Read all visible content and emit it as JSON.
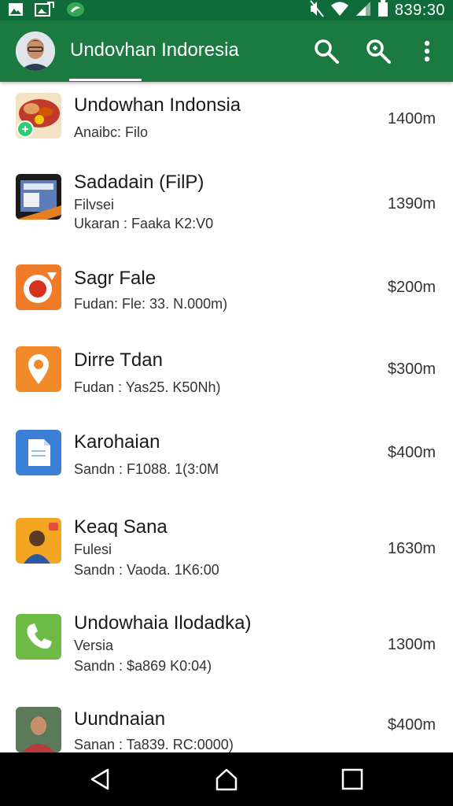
{
  "status_bar": {
    "time": "839:30",
    "icons": [
      "gallery-icon",
      "image-icon",
      "leaf-app-icon",
      "mute-icon",
      "wifi-icon",
      "signal-icon",
      "battery-icon"
    ]
  },
  "app_bar": {
    "title": "Undovhan Indoresia",
    "icons": [
      "search-icon",
      "zoom-search-icon",
      "more-vert-icon"
    ],
    "color": "#1a7a40"
  },
  "list": [
    {
      "title": "Undowhan Indonsia",
      "lines": [
        "Anaibc: Filo"
      ],
      "amount": "1400m",
      "thumb": "food-thumbnail"
    },
    {
      "title": "Sadadain (FilP)",
      "lines": [
        "Filvsei",
        "Ukaran : Faaka  K2:V0"
      ],
      "amount": "1390m",
      "thumb": "device-thumbnail"
    },
    {
      "title": "Sagr Fale",
      "lines": [
        "Fudan: Fle: 33. N.000m)"
      ],
      "amount": "$200m",
      "thumb": "record-app-icon"
    },
    {
      "title": "Dirre Tdan",
      "lines": [
        "Fudan : Yas25. K50Nh)"
      ],
      "amount": "$300m",
      "thumb": "pin-app-icon"
    },
    {
      "title": "Karohaian",
      "lines": [
        "Sandn : F1088. 1(3:0M"
      ],
      "amount": "$400m",
      "thumb": "document-app-icon"
    },
    {
      "title": "Keaq Sana",
      "lines": [
        "Fulesi",
        "Sandn : Vaoda. 1K6:00"
      ],
      "amount": "1630m",
      "thumb": "person-thumbnail"
    },
    {
      "title": "Undowhaia Ilodadka)",
      "lines": [
        "Versia",
        "Sandn : $a869  K0:04)"
      ],
      "amount": "1300m",
      "thumb": "phone-app-icon"
    },
    {
      "title": "Uundnaian",
      "lines": [
        "Sanan : Ta839. RC:0000)"
      ],
      "amount": "$400m",
      "thumb": "portrait-thumbnail"
    }
  ],
  "nav_bar": {
    "buttons": [
      "back-icon",
      "home-icon",
      "recents-icon"
    ]
  }
}
